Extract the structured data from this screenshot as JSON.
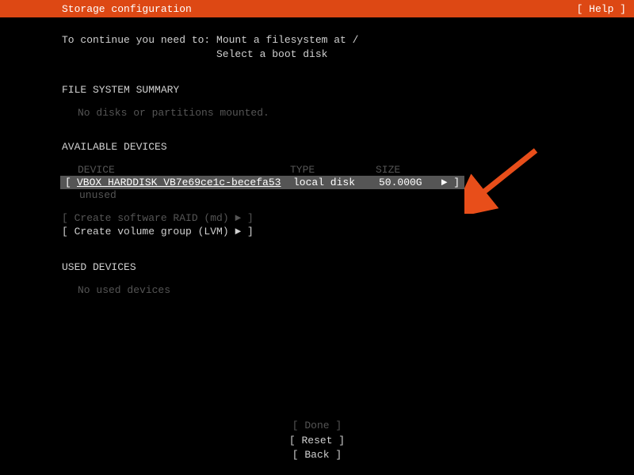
{
  "header": {
    "title": "Storage configuration",
    "help": "[ Help ]"
  },
  "instructions": {
    "line1": "To continue you need to: Mount a filesystem at /",
    "line2": "Select a boot disk"
  },
  "file_system_summary": {
    "title": "FILE SYSTEM SUMMARY",
    "message": "No disks or partitions mounted."
  },
  "available_devices": {
    "title": "AVAILABLE DEVICES",
    "headers": {
      "device": "DEVICE",
      "type": "TYPE",
      "size": "SIZE"
    },
    "rows": [
      {
        "device": "VBOX_HARDDISK_VB7e69ce1c-becefa53",
        "type": "local disk",
        "size": "50.000G",
        "marker": "► ]"
      }
    ],
    "unused": "unused",
    "options": {
      "raid": "[ Create software RAID (md) ► ]",
      "lvm": "[ Create volume group (LVM) ► ]"
    }
  },
  "used_devices": {
    "title": "USED DEVICES",
    "message": "No used devices"
  },
  "buttons": {
    "done": "[ Done       ]",
    "reset": "[ Reset      ]",
    "back": "[ Back       ]"
  }
}
